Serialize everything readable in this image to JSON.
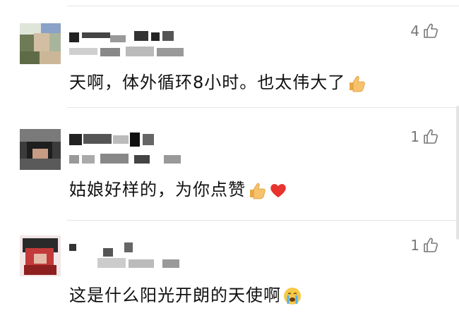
{
  "comments": [
    {
      "text": "天啊，体外循环8小时。也太伟大了",
      "emoji": "thumbs-up",
      "likes": "4"
    },
    {
      "text": "姑娘好样的，为你点赞",
      "emoji": "thumbs-up-heart",
      "likes": "1"
    },
    {
      "text": "这是什么阳光开朗的天使啊",
      "emoji": "crying-face",
      "likes": "1"
    }
  ],
  "colors": {
    "text": "#111111",
    "meta": "#777777",
    "divider": "#e6e6e6"
  }
}
